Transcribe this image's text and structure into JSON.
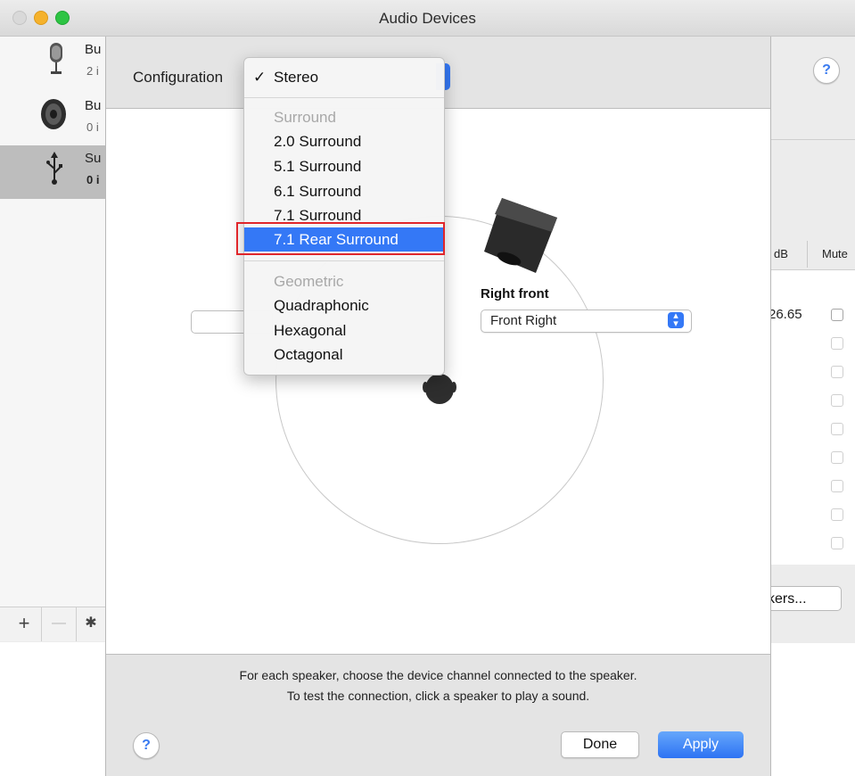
{
  "window": {
    "title": "Audio Devices"
  },
  "sidebar": {
    "devices": [
      {
        "name": "Bu",
        "sub": "2 i",
        "icon": "microphone-icon"
      },
      {
        "name": "Bu",
        "sub": "0 i",
        "icon": "speaker-icon"
      },
      {
        "name": "Su",
        "sub": "0 i",
        "icon": "usb-icon"
      }
    ],
    "add_label": "+",
    "remove_label": "—",
    "gear_label": "✱"
  },
  "sheet": {
    "configuration_label": "Configuration",
    "right_front_label": "Right front",
    "right_front_value": "Front Right",
    "hint_line1": "For each speaker, choose the device channel connected to the speaker.",
    "hint_line2": "To test the connection, click a speaker to play a sound.",
    "help_label": "?",
    "done_label": "Done",
    "apply_label": "Apply"
  },
  "menu": {
    "checked": "Stereo",
    "check_glyph": "✓",
    "items": [
      {
        "label": "Stereo"
      },
      {
        "label": "Surround"
      },
      {
        "label": "2.0 Surround"
      },
      {
        "label": "5.1 Surround"
      },
      {
        "label": "6.1 Surround"
      },
      {
        "label": "7.1 Surround"
      },
      {
        "label": "7.1 Rear Surround"
      },
      {
        "label": "Geometric"
      },
      {
        "label": "Quadraphonic"
      },
      {
        "label": "Hexagonal"
      },
      {
        "label": "Octagonal"
      }
    ]
  },
  "right_panel": {
    "col_db": "dB",
    "col_mute": "Mute",
    "db_value": "26.65",
    "configure_speakers_label": "kers...",
    "help_label": "?"
  },
  "colors": {
    "accent": "#3478f6",
    "highlight_border": "#e0262b"
  }
}
